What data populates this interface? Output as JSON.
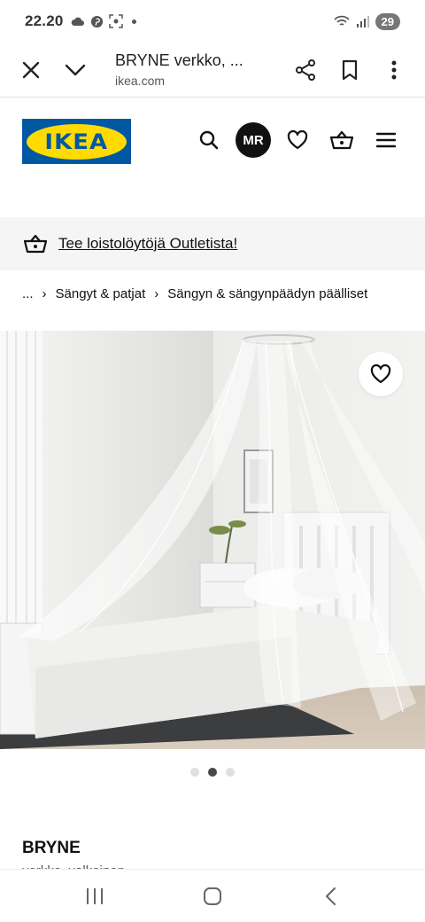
{
  "status_bar": {
    "time": "22.20",
    "battery": "29"
  },
  "browser": {
    "title": "BRYNE verkko, ...",
    "url": "ikea.com",
    "icons": [
      "close-icon",
      "chevron-down-icon",
      "share-icon",
      "bookmark-icon",
      "more-vertical-icon"
    ]
  },
  "header": {
    "logo_text": "IKEA",
    "avatar_initials": "MR",
    "brand_colors": {
      "blue": "#0058a3",
      "yellow": "#ffdb00"
    },
    "icons": [
      "search-icon",
      "heart-icon",
      "basket-icon",
      "menu-icon"
    ]
  },
  "promo": {
    "text": "Tee loistolöytöjä Outletista!",
    "icon": "basket-icon"
  },
  "breadcrumb": {
    "ellipsis": "...",
    "items": [
      "Sängyt & patjat",
      "Sängyn & sängynpäädyn päälliset"
    ]
  },
  "carousel": {
    "count": 3,
    "active": 2
  },
  "product": {
    "name": "BRYNE",
    "subtitle": "verkko, valkoinen"
  },
  "system_nav": {
    "icons": [
      "recents-icon",
      "home-icon",
      "back-icon"
    ]
  }
}
